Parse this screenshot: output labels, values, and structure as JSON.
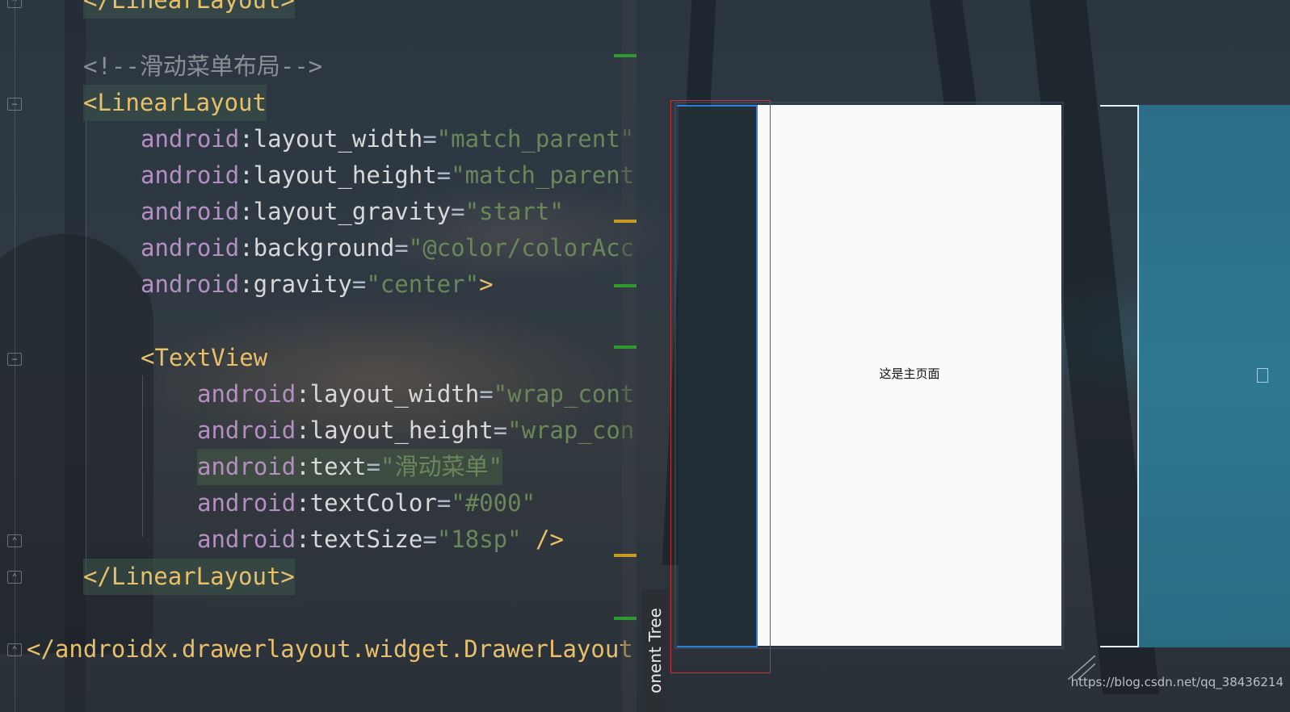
{
  "editor": {
    "lines": [
      {
        "segments": [
          {
            "t": "</LinearLayout>",
            "c": "tag"
          }
        ]
      },
      {
        "segments": [
          {
            "t": "<!--滑动菜单布局-->",
            "c": "comment"
          }
        ]
      },
      {
        "segments": [
          {
            "t": "<LinearLayout",
            "c": "tag"
          }
        ]
      },
      {
        "segments": [
          {
            "t": "android",
            "c": "ns"
          },
          {
            "t": ":layout_width",
            "c": "attr"
          },
          {
            "t": "=",
            "c": "eq"
          },
          {
            "t": "\"match_parent\"",
            "c": "val"
          }
        ]
      },
      {
        "segments": [
          {
            "t": "android",
            "c": "ns"
          },
          {
            "t": ":layout_height",
            "c": "attr"
          },
          {
            "t": "=",
            "c": "eq"
          },
          {
            "t": "\"match_parent",
            "c": "val"
          }
        ]
      },
      {
        "segments": [
          {
            "t": "android",
            "c": "ns"
          },
          {
            "t": ":layout_gravity",
            "c": "attr"
          },
          {
            "t": "=",
            "c": "eq"
          },
          {
            "t": "\"start\"",
            "c": "val"
          }
        ]
      },
      {
        "segments": [
          {
            "t": "android",
            "c": "ns"
          },
          {
            "t": ":background",
            "c": "attr"
          },
          {
            "t": "=",
            "c": "eq"
          },
          {
            "t": "\"@color/colorAcc",
            "c": "val"
          }
        ]
      },
      {
        "segments": [
          {
            "t": "android",
            "c": "ns"
          },
          {
            "t": ":gravity",
            "c": "attr"
          },
          {
            "t": "=",
            "c": "eq"
          },
          {
            "t": "\"center\"",
            "c": "val"
          },
          {
            "t": ">",
            "c": "tag"
          }
        ]
      },
      {
        "segments": [
          {
            "t": "<TextView",
            "c": "tag"
          }
        ]
      },
      {
        "segments": [
          {
            "t": "android",
            "c": "ns"
          },
          {
            "t": ":layout_width",
            "c": "attr"
          },
          {
            "t": "=",
            "c": "eq"
          },
          {
            "t": "\"wrap_cont",
            "c": "val"
          }
        ]
      },
      {
        "segments": [
          {
            "t": "android",
            "c": "ns"
          },
          {
            "t": ":layout_height",
            "c": "attr"
          },
          {
            "t": "=",
            "c": "eq"
          },
          {
            "t": "\"wrap_con",
            "c": "val"
          }
        ]
      },
      {
        "segments": [
          {
            "t": "android",
            "c": "ns"
          },
          {
            "t": ":text",
            "c": "attr"
          },
          {
            "t": "=",
            "c": "eq"
          },
          {
            "t": "\"滑动菜单\"",
            "c": "val"
          }
        ]
      },
      {
        "segments": [
          {
            "t": "android",
            "c": "ns"
          },
          {
            "t": ":textColor",
            "c": "attr"
          },
          {
            "t": "=",
            "c": "eq"
          },
          {
            "t": "\"#000\"",
            "c": "val"
          }
        ]
      },
      {
        "segments": [
          {
            "t": "android",
            "c": "ns"
          },
          {
            "t": ":textSize",
            "c": "attr"
          },
          {
            "t": "=",
            "c": "eq"
          },
          {
            "t": "\"18sp\"",
            "c": "val"
          },
          {
            "t": " />",
            "c": "tag"
          }
        ]
      },
      {
        "segments": [
          {
            "t": "</LinearLayout>",
            "c": "tag"
          }
        ]
      },
      {
        "segments": [
          {
            "t": "</androidx.drawerlayout.widget.DrawerLayout",
            "c": "tag"
          }
        ]
      }
    ]
  },
  "preview": {
    "component_tree_tab": "onent Tree",
    "main_page_text": "这是主页面"
  },
  "watermark": "https://blog.csdn.net/qq_38436214",
  "colors": {
    "tag": "#e8bf6a",
    "namespace": "#b58fc2",
    "value": "#6a8759",
    "comment": "#8a9095",
    "selection_blue": "#2f7fd8",
    "selection_red": "#c0323a"
  }
}
